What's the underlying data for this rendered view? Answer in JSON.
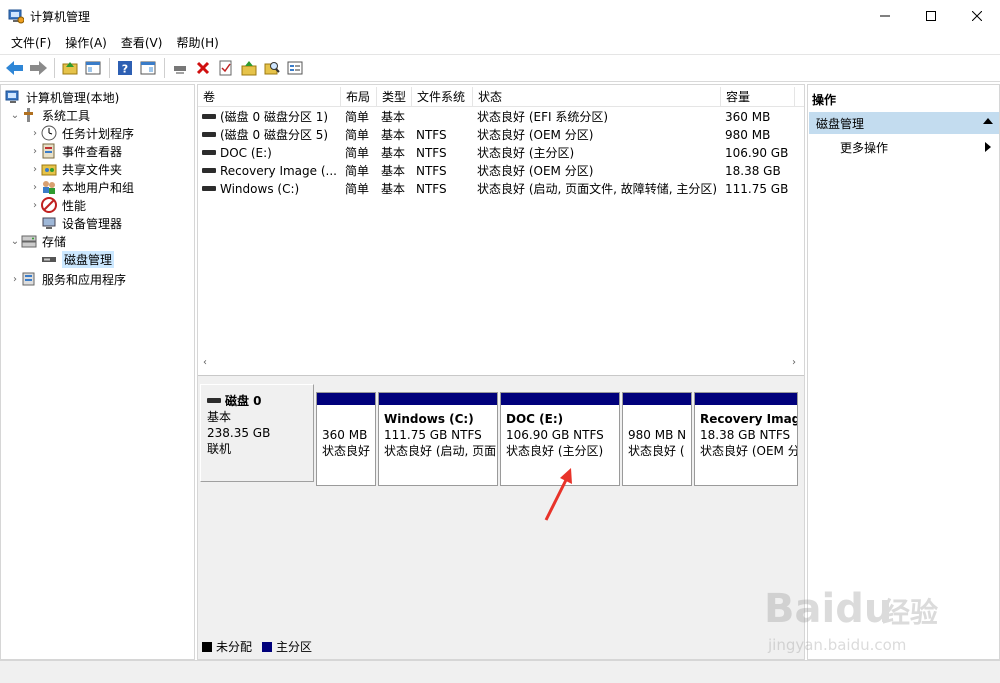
{
  "window": {
    "title": "计算机管理"
  },
  "menu": [
    "文件(F)",
    "操作(A)",
    "查看(V)",
    "帮助(H)"
  ],
  "tree": [
    {
      "label": "计算机管理(本地)",
      "level": 0,
      "expander": "",
      "icon": "computer-management-icon"
    },
    {
      "label": "系统工具",
      "level": 1,
      "expander": "v",
      "icon": "system-tools-icon"
    },
    {
      "label": "任务计划程序",
      "level": 2,
      "expander": ">",
      "icon": "clock-icon"
    },
    {
      "label": "事件查看器",
      "level": 2,
      "expander": ">",
      "icon": "event-viewer-icon"
    },
    {
      "label": "共享文件夹",
      "level": 2,
      "expander": ">",
      "icon": "shared-folder-icon"
    },
    {
      "label": "本地用户和组",
      "level": 2,
      "expander": ">",
      "icon": "users-icon"
    },
    {
      "label": "性能",
      "level": 2,
      "expander": ">",
      "icon": "performance-icon"
    },
    {
      "label": "设备管理器",
      "level": 2,
      "expander": "",
      "icon": "device-manager-icon"
    },
    {
      "label": "存储",
      "level": 1,
      "expander": "v",
      "icon": "storage-icon"
    },
    {
      "label": "磁盘管理",
      "level": 2,
      "expander": "",
      "icon": "disk-icon",
      "selected": true
    },
    {
      "label": "服务和应用程序",
      "level": 1,
      "expander": ">",
      "icon": "services-icon"
    }
  ],
  "volumes": {
    "headers": [
      "卷",
      "布局",
      "类型",
      "文件系统",
      "状态",
      "容量"
    ],
    "rows": [
      [
        "(磁盘 0 磁盘分区 1)",
        "简单",
        "基本",
        "",
        "状态良好 (EFI 系统分区)",
        "360 MB"
      ],
      [
        "(磁盘 0 磁盘分区 5)",
        "简单",
        "基本",
        "NTFS",
        "状态良好 (OEM 分区)",
        "980 MB"
      ],
      [
        "DOC (E:)",
        "简单",
        "基本",
        "NTFS",
        "状态良好 (主分区)",
        "106.90 GB"
      ],
      [
        "Recovery Image (...",
        "简单",
        "基本",
        "NTFS",
        "状态良好 (OEM 分区)",
        "18.38 GB"
      ],
      [
        "Windows (C:)",
        "简单",
        "基本",
        "NTFS",
        "状态良好 (启动, 页面文件, 故障转储, 主分区)",
        "111.75 GB"
      ]
    ]
  },
  "disk": {
    "name": "磁盘 0",
    "type": "基本",
    "size": "238.35 GB",
    "state": "联机",
    "partitions": [
      {
        "title": "",
        "size": "360 MB",
        "status": "状态良好"
      },
      {
        "title": "Windows (C:)",
        "size": "111.75 GB NTFS",
        "status": "状态良好 (启动, 页面"
      },
      {
        "title": "DOC (E:)",
        "size": "106.90 GB NTFS",
        "status": "状态良好 (主分区)"
      },
      {
        "title": "",
        "size": "980 MB N",
        "status": "状态良好 ("
      },
      {
        "title": "Recovery Imag",
        "size": "18.38 GB NTFS",
        "status": "状态良好 (OEM 分"
      }
    ]
  },
  "legend": [
    {
      "label": "未分配",
      "color": "#000000"
    },
    {
      "label": "主分区",
      "color": "#00007b"
    }
  ],
  "actions": {
    "title": "操作",
    "section": "磁盘管理",
    "items": [
      "更多操作"
    ]
  },
  "colors": {
    "partition_bar": "#00007b",
    "selection": "#cce8ff",
    "action_header": "#c3dcef",
    "annotation_arrow": "#e8332a"
  },
  "watermark": {
    "brand": "Baidu",
    "brand_cn": "经验",
    "url": "jingyan.baidu.com"
  }
}
